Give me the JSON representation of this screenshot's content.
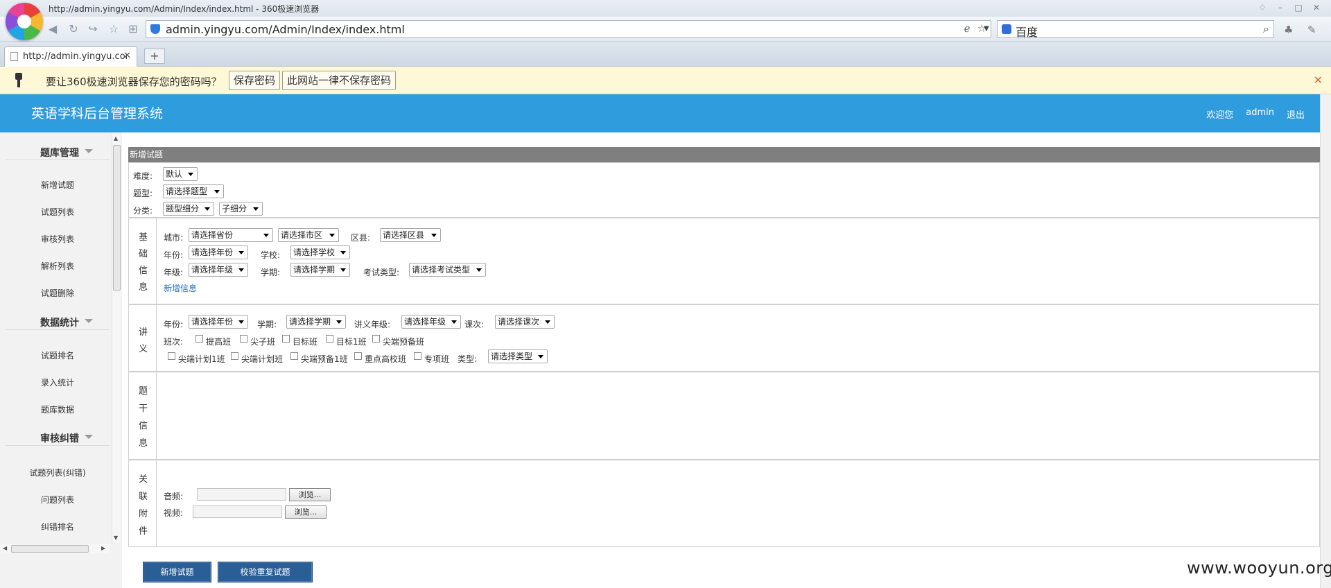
{
  "browser": {
    "window_title": "http://admin.yingyu.com/Admin/Index/index.html - 360极速浏览器",
    "address": "admin.yingyu.com/Admin/Index/index.html",
    "search_engine": "百度",
    "tab_title": "http://admin.yingyu.com/Admin/Index/index.html",
    "new_tab": "+",
    "infobar": {
      "text": "要让360极速浏览器保存您的密码吗？",
      "save_label": "保存密码",
      "never_label": "此网站一律不保存密码"
    }
  },
  "header": {
    "title": "英语学科后台管理系统",
    "welcome": "欢迎您",
    "user": "admin",
    "logout": "退出"
  },
  "sidebar": {
    "sections": [
      {
        "label": "题库管理",
        "items": [
          "新增试题",
          "试题列表",
          "审核列表",
          "解析列表",
          "试题删除"
        ]
      },
      {
        "label": "数据统计",
        "items": [
          "试题排名",
          "录入统计",
          "题库数据"
        ]
      },
      {
        "label": "审核纠错",
        "items": [
          "试题列表(纠错)",
          "问题列表",
          "纠错排名"
        ]
      }
    ]
  },
  "form": {
    "title": "新增试题",
    "difficulty": {
      "label": "难度:",
      "value": "默认"
    },
    "question_type": {
      "label": "题型:",
      "value": "请选择题型"
    },
    "category": {
      "label": "分类:",
      "value": "题型细分",
      "sub_value": "子细分"
    },
    "basic": {
      "section_label": [
        "基",
        "础",
        "信",
        "息"
      ],
      "city_label": "城市:",
      "province": "请选择省份",
      "city": "请选择市区",
      "district_label": "区县:",
      "district": "请选择区县",
      "year_label": "年份:",
      "year": "请选择年份",
      "school_label": "学校:",
      "school": "请选择学校",
      "grade_label": "年级:",
      "grade": "请选择年级",
      "term_label": "学期:",
      "term": "请选择学期",
      "exam_type_label": "考试类型:",
      "exam_type": "请选择考试类型",
      "add_info": "新增信息"
    },
    "lecture": {
      "section_label": [
        "讲",
        "义"
      ],
      "year_label": "年份:",
      "year": "请选择年份",
      "term_label": "学期:",
      "term": "请选择学期",
      "grade_label": "讲义年级:",
      "grade": "请选择年级",
      "lesson_label": "课次:",
      "lesson": "请选择课次",
      "class_label": "班次:",
      "classes_row1": [
        "提高班",
        "尖子班",
        "目标班",
        "目标1班",
        "尖端预备班"
      ],
      "classes_row2": [
        "尖端计划1班",
        "尖端计划班",
        "尖端预备1班",
        "重点高校班",
        "专项班"
      ],
      "type_label": "类型:",
      "type": "请选择类型"
    },
    "stem": {
      "section_label": [
        "题",
        "干",
        "信",
        "息"
      ]
    },
    "attach": {
      "section_label": [
        "关",
        "联",
        "附",
        "件"
      ],
      "audio_label": "音频:",
      "video_label": "视频:",
      "browse": "浏览..."
    },
    "buttons": {
      "add": "新增试题",
      "check_dup": "校验重复试题"
    }
  },
  "watermark": "www.wooyun.org"
}
